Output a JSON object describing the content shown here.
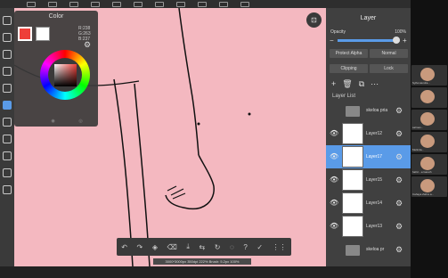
{
  "app": {
    "document_status": "3000*3000px 350dpi 222% Brush: 5.2px 100%"
  },
  "colors": {
    "accent": "#5a9be8",
    "canvas": "#f4b8c0",
    "primary": "#ee3f39",
    "secondary": "#ffffff"
  },
  "color_panel": {
    "title": "Color",
    "r": "R:238",
    "g": "G:263",
    "b": "B:237"
  },
  "layer_panel": {
    "title": "Layer",
    "opacity_label": "Opacity",
    "opacity_value": "100%",
    "protect_alpha": "Protect Alpha",
    "blend_mode": "Normal",
    "clipping": "Clipping",
    "lock": "Lock",
    "list_label": "Layer List",
    "layers": [
      {
        "label": "skeloa pria",
        "type": "folder",
        "visible": false,
        "selected": false
      },
      {
        "label": "Layer12",
        "type": "layer",
        "visible": true,
        "selected": false
      },
      {
        "label": "Layer17",
        "type": "layer",
        "visible": true,
        "selected": true
      },
      {
        "label": "Layer15",
        "type": "layer",
        "visible": true,
        "selected": false
      },
      {
        "label": "Layer14",
        "type": "layer",
        "visible": true,
        "selected": false
      },
      {
        "label": "Layer13",
        "type": "layer",
        "visible": true,
        "selected": false
      },
      {
        "label": "skeloa pr",
        "type": "folder",
        "visible": false,
        "selected": false
      }
    ]
  },
  "participants": [
    {
      "name": "Syifa Hendra..."
    },
    {
      "name": ""
    },
    {
      "name": "salman..."
    },
    {
      "name": "Melinda..."
    },
    {
      "name": "hafid ...a Gareth"
    },
    {
      "name": "Cahaya Zahra a..."
    }
  ]
}
